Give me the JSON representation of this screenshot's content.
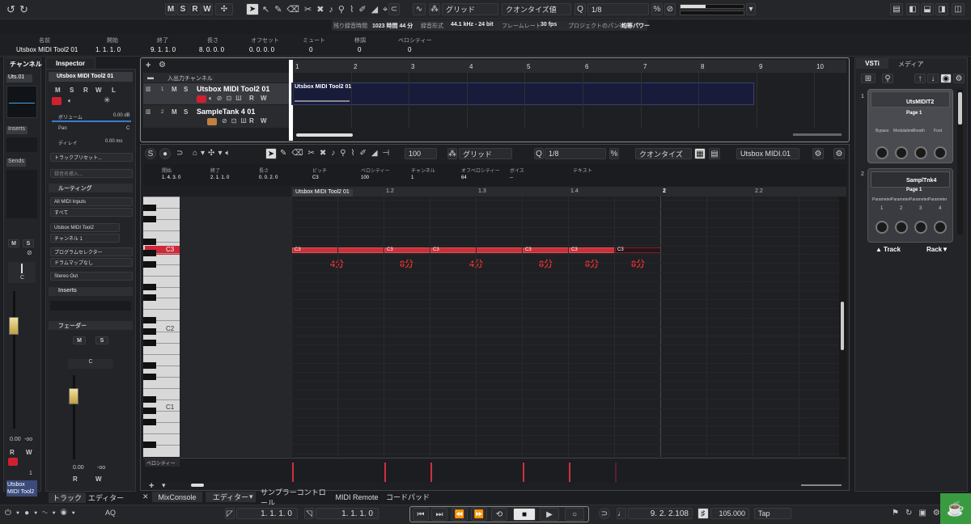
{
  "toolbar": {
    "m": "M",
    "s": "S",
    "r": "R",
    "w": "W",
    "grid": "グリッド",
    "quantize": "クオンタイズ値",
    "quant_value": "1/8"
  },
  "status": {
    "rec_time_label": "残り録音時間",
    "rec_time": "1023 時間 44 分",
    "rec_format_label": "録音形式",
    "rec_format": "44.1 kHz - 24 bit",
    "frame_rate_label": "フレームレート",
    "frame_rate": "30 fps",
    "pan_law_label": "プロジェクトのパン補正",
    "pan_law": "均等パワー"
  },
  "infoline": {
    "name_h": "名前",
    "name": "Utsbox MIDI Tool2 01",
    "start_h": "開始",
    "start": "1. 1. 1. 0",
    "end_h": "終了",
    "end": "9. 1. 1. 0",
    "len_h": "長さ",
    "len": "8. 0. 0. 0",
    "offset_h": "オフセット",
    "offset": "0. 0. 0. 0",
    "mute_h": "ミュート",
    "mute": "0",
    "transpose_h": "移調",
    "transpose": "0",
    "velocity_h": "ベロシティー",
    "velocity": "0"
  },
  "left": {
    "channel_tab": "チャンネル",
    "inspector_tab": "Inspector",
    "ch_name": "Uts.01",
    "inserts": "Inserts",
    "sends": "Sends",
    "fader_m": "M",
    "fader_s": "S",
    "ch_vol": "0.00",
    "ch_inf": "-oo",
    "ch_r": "R",
    "ch_w": "W",
    "ch_num": "1",
    "ch_track": "Utsbox MIDI Tool2 01",
    "track_tab": "トラック",
    "editor_tab": "エディター"
  },
  "inspector": {
    "title": "Utsbox MIDI Tool2 01",
    "m": "M",
    "s": "S",
    "r": "R",
    "w": "W",
    "l": "L",
    "volume_label": "ボリューム",
    "volume": "0.00 dB",
    "pan_label": "Pan",
    "pan": "C",
    "delay_label": "ディレイ",
    "delay": "0.00 ms",
    "preset": "トラックプリセット...",
    "insert_ph": "録音名挿入...",
    "routing": "ルーティング",
    "in": "All MIDI Inputs",
    "in2": "すべて",
    "out": "Utsbox MIDI Tool2",
    "chan": "チャンネル 1",
    "prog": "プログラムセレクター",
    "drum": "ドラムマップなし",
    "stereo": "Stereo Out",
    "inserts": "Inserts",
    "fader": "フェーダー",
    "fm": "M",
    "fs": "S",
    "fc": "C",
    "fvol": "0.00",
    "finf": "-oo",
    "fr": "R",
    "fw": "W"
  },
  "project": {
    "io_track": "入出力チャンネル",
    "track1": "Utsbox MIDI Tool2 01",
    "track2": "SampleTank 4 01",
    "t1num": "1",
    "t2num": "2",
    "part": "Utsbox MIDI Tool2 01",
    "ruler": [
      "1",
      "2",
      "3",
      "4",
      "5",
      "6",
      "7",
      "8",
      "9",
      "10"
    ],
    "ms": "M",
    "ss": "S",
    "rs": "R",
    "ws": "W"
  },
  "editor": {
    "vel": "100",
    "grid": "グリッド",
    "qv": "1/8",
    "quant": "クオンタイズ",
    "track": "Utsbox MIDI.01",
    "info_h": [
      "開始",
      "終了",
      "長さ",
      "ピッチ",
      "ベロシティー",
      "チャンネル",
      "オフベロシティー",
      "ボイス",
      "テキスト"
    ],
    "info_v": [
      "1. 4. 3. 0",
      "2. 1. 1. 0",
      "0. 0. 2. 0",
      "C3",
      "100",
      "1",
      "64",
      "--",
      ""
    ],
    "part": "Utsbox MIDI Tool2 01",
    "ruler": [
      "1.2",
      "1.3",
      "1.4",
      "2",
      "2.2"
    ],
    "c3": "C3",
    "c2": "C2",
    "c1": "C1",
    "vel_label": "ベロシティー",
    "notes": [
      "C3",
      "C3",
      "C3",
      "C3",
      "C3",
      "C3"
    ],
    "lens": [
      "4分",
      "8分",
      "4分",
      "8分",
      "8分",
      "8分"
    ]
  },
  "right": {
    "vsti_tab": "VSTi",
    "media_tab": "メディア",
    "inst1": "UtsMIDIT2",
    "inst1_page": "Page 1",
    "inst1_params": [
      "Bypass",
      "Modulation",
      "Breath",
      "Foot"
    ],
    "inst2": "SamplTnk4",
    "inst2_page": "Page 1",
    "inst2_params": [
      "Parameter",
      "Parameter",
      "Parameter",
      "Parameter"
    ],
    "inst2_nums": [
      "1",
      "2",
      "3",
      "4"
    ],
    "n1": "1",
    "n2": "2",
    "track": "Track",
    "rack": "Rack"
  },
  "bottom": {
    "tabs": [
      "MixConsole",
      "エディター",
      "サンプラーコントロール",
      "MIDI Remote",
      "コードパッド"
    ]
  },
  "transport": {
    "aq": "AQ",
    "pos1": "1. 1. 1. 0",
    "pos2": "1. 1. 1. 0",
    "pos3": "9. 2. 2.108",
    "tempo": "105.000",
    "tap": "Tap"
  }
}
